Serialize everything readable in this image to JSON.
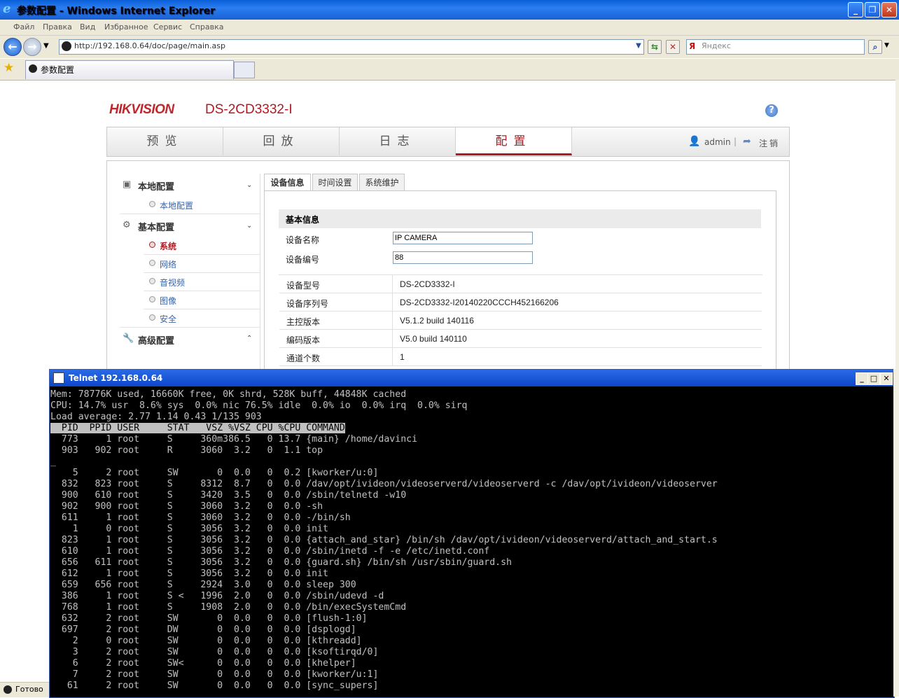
{
  "browser": {
    "window_title": "参数配置 - Windows Internet Explorer",
    "menu": [
      "Файл",
      "Правка",
      "Вид",
      "Избранное",
      "Сервис",
      "Справка"
    ],
    "address": "http://192.168.0.64/doc/page/main.asp",
    "search_placeholder": "Яндекс",
    "tab_label": "参数配置",
    "status_text": "Готово"
  },
  "page": {
    "brand": "HIKVISION",
    "model": "DS-2CD3332-I",
    "nav": [
      "预览",
      "回放",
      "日志",
      "配置"
    ],
    "user": "admin",
    "logout": "注销",
    "sidebar": {
      "local": {
        "title": "本地配置",
        "items": [
          "本地配置"
        ]
      },
      "basic": {
        "title": "基本配置",
        "items": [
          "系统",
          "网络",
          "音视频",
          "图像",
          "安全"
        ]
      },
      "advanced": {
        "title": "高级配置"
      }
    },
    "config_tabs": [
      "设备信息",
      "时间设置",
      "系统维护"
    ],
    "section_title": "基本信息",
    "fields": [
      {
        "label": "设备名称",
        "value": "IP CAMERA"
      },
      {
        "label": "设备编号",
        "value": "88"
      }
    ],
    "info_rows": [
      {
        "label": "设备型号",
        "value": "DS-2CD3332-I"
      },
      {
        "label": "设备序列号",
        "value": "DS-2CD3332-I20140220CCCH452166206"
      },
      {
        "label": "主控版本",
        "value": "V5.1.2 build 140116"
      },
      {
        "label": "编码版本",
        "value": "V5.0 build 140110"
      },
      {
        "label": "通道个数",
        "value": "1"
      }
    ]
  },
  "telnet": {
    "title": "Telnet 192.168.0.64",
    "lines": [
      "Mem: 78776K used, 16660K free, 0K shrd, 528K buff, 44848K cached",
      "CPU: 14.7% usr  8.6% sys  0.0% nic 76.5% idle  0.0% io  0.0% irq  0.0% sirq",
      "Load average: 2.77 1.14 0.43 1/135 903",
      "  PID  PPID USER     STAT   VSZ %VSZ CPU %CPU COMMAND",
      "  773     1 root     S     360m386.5   0 13.7 {main} /home/davinci",
      "  903   902 root     R     3060  3.2   0  1.1 top",
      "_",
      "    5     2 root     SW       0  0.0   0  0.2 [kworker/u:0]",
      "  832   823 root     S     8312  8.7   0  0.0 /dav/opt/ivideon/videoserverd/videoserverd -c /dav/opt/ivideon/videoserver",
      "  900   610 root     S     3420  3.5   0  0.0 /sbin/telnetd -w10",
      "  902   900 root     S     3060  3.2   0  0.0 -sh",
      "  611     1 root     S     3060  3.2   0  0.0 -/bin/sh",
      "    1     0 root     S     3056  3.2   0  0.0 init",
      "  823     1 root     S     3056  3.2   0  0.0 {attach_and_star} /bin/sh /dav/opt/ivideon/videoserverd/attach_and_start.s",
      "  610     1 root     S     3056  3.2   0  0.0 /sbin/inetd -f -e /etc/inetd.conf",
      "  656   611 root     S     3056  3.2   0  0.0 {guard.sh} /bin/sh /usr/sbin/guard.sh",
      "  612     1 root     S     3056  3.2   0  0.0 init",
      "  659   656 root     S     2924  3.0   0  0.0 sleep 300",
      "  386     1 root     S <   1996  2.0   0  0.0 /sbin/udevd -d",
      "  768     1 root     S     1908  2.0   0  0.0 /bin/execSystemCmd",
      "  632     2 root     SW       0  0.0   0  0.0 [flush-1:0]",
      "  697     2 root     DW       0  0.0   0  0.0 [dsplogd]",
      "    2     0 root     SW       0  0.0   0  0.0 [kthreadd]",
      "    3     2 root     SW       0  0.0   0  0.0 [ksoftirqd/0]",
      "    6     2 root     SW<      0  0.0   0  0.0 [khelper]",
      "    7     2 root     SW       0  0.0   0  0.0 [kworker/u:1]",
      "   61     2 root     SW       0  0.0   0  0.0 [sync_supers]"
    ]
  }
}
